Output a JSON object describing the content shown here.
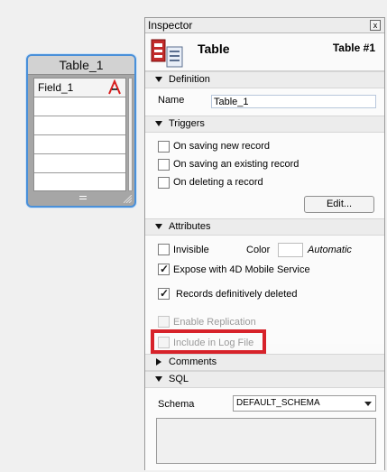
{
  "table_widget": {
    "title": "Table_1",
    "rows": [
      {
        "name": "Field_1"
      },
      {
        "name": ""
      },
      {
        "name": ""
      },
      {
        "name": ""
      },
      {
        "name": ""
      },
      {
        "name": ""
      }
    ],
    "field_type_icon": "alpha-field-icon"
  },
  "inspector": {
    "window_title": "Inspector",
    "close_label": "x",
    "header": {
      "title": "Table",
      "table_id": "Table #1",
      "icon": "table-properties-icon"
    },
    "definition": {
      "header": "Definition",
      "name_label": "Name",
      "name_value": "Table_1"
    },
    "triggers": {
      "header": "Triggers",
      "items": [
        {
          "label": "On saving new record",
          "checked": false
        },
        {
          "label": "On saving an existing record",
          "checked": false
        },
        {
          "label": "On deleting a record",
          "checked": false
        }
      ],
      "edit_button": "Edit..."
    },
    "attributes": {
      "header": "Attributes",
      "invisible": {
        "label": "Invisible",
        "checked": false
      },
      "color_label": "Color",
      "color_value": "Automatic",
      "expose": {
        "label": "Expose with 4D Mobile Service",
        "checked": true
      },
      "deleted": {
        "label": "Records definitively deleted",
        "checked": true
      },
      "replication": {
        "label": "Enable Replication",
        "checked": false,
        "disabled": true
      },
      "log": {
        "label": "Include in Log File",
        "checked": false,
        "disabled": true
      }
    },
    "comments": {
      "header": "Comments"
    },
    "sql": {
      "header": "SQL",
      "schema_label": "Schema",
      "schema_value": "DEFAULT_SCHEMA"
    }
  }
}
